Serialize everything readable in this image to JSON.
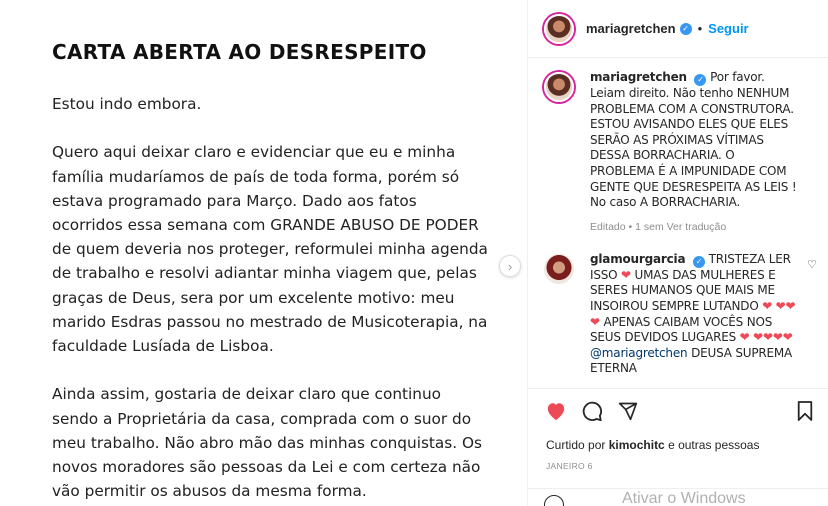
{
  "post": {
    "title": "CARTA ABERTA AO DESRESPEITO",
    "paragraphs": [
      "Estou indo embora.",
      "Quero aqui deixar claro e evidenciar que eu e minha família mudaríamos de país de toda forma, porém só estava programado para Março. Dado aos fatos ocorridos essa semana com GRANDE ABUSO DE PODER de quem deveria nos proteger, reformulei minha agenda de trabalho e resolvi adiantar minha viagem que, pelas graças de Deus, sera por um excelente motivo: meu marido Esdras passou no mestrado de Musicoterapia, na faculdade Lusíada de Lisboa.",
      "Ainda assim, gostaria de deixar claro que continuo sendo a Proprietária da casa, comprada com o suor do meu trabalho. Não abro mão das minhas conquistas. Os novos moradores são pessoas da Lei e com certeza não vão permitir os abusos da mesma forma."
    ]
  },
  "header": {
    "username": "mariagretchen",
    "separator": "•",
    "follow_label": "Seguir"
  },
  "comments": [
    {
      "username": "mariagretchen",
      "text": "Por favor. Leiam direito. Não tenho NENHUM PROBLEMA COM A CONSTRUTORA. ESTOU AVISANDO ELES QUE ELES SERÃO AS PRÓXIMAS VÍTIMAS DESSA BORRACHARIA. O PROBLEMA É A IMPUNIDADE COM GENTE QUE DESRESPEITA AS LEIS ! No caso A BORRACHARIA.",
      "meta": "Editado • 1 sem    Ver tradução"
    },
    {
      "username": "glamourgarcia",
      "text_a": "TRISTEZA LER ISSO",
      "text_b": "UMAS DAS MULHERES E SERES HUMANOS QUE MAIS ME INSOIROU SEMPRE LUTANDO",
      "text_c": "APENAS CAIBAM VOCÊS NOS SEUS DEVIDOS LUGARES",
      "mention": "@mariagretchen",
      "text_d": "DEUSA SUPREMA ETERNA"
    }
  ],
  "actions": {
    "liked_by_prefix": "Curtido por",
    "liked_by_user": "kimochitc",
    "liked_by_suffix": "e outras pessoas",
    "date": "JANEIRO 6"
  },
  "overlay": {
    "watermark": "Ativar o Windows"
  }
}
